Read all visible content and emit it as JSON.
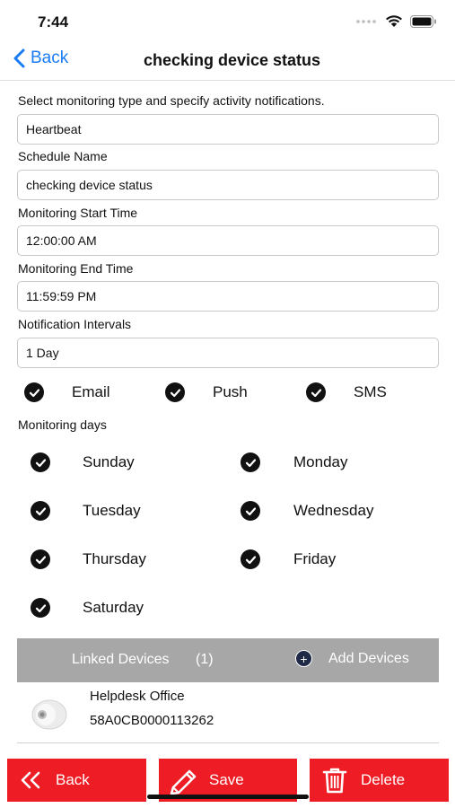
{
  "status": {
    "time": "7:44"
  },
  "nav": {
    "back_label": "Back",
    "title": "checking device status"
  },
  "form": {
    "instruction": "Select monitoring type and specify activity notifications.",
    "monitoring_type_value": "Heartbeat",
    "schedule_name_label": "Schedule Name",
    "schedule_name_value": "checking device status",
    "start_time_label": "Monitoring Start Time",
    "start_time_value": "12:00:00 AM",
    "end_time_label": "Monitoring End Time",
    "end_time_value": "11:59:59 PM",
    "interval_label": "Notification Intervals",
    "interval_value": "1 Day"
  },
  "notifications": [
    {
      "label": "Email",
      "checked": true
    },
    {
      "label": "Push",
      "checked": true
    },
    {
      "label": "SMS",
      "checked": true
    }
  ],
  "days": {
    "label": "Monitoring days",
    "items": [
      {
        "label": "Sunday",
        "checked": true
      },
      {
        "label": "Monday",
        "checked": true
      },
      {
        "label": "Tuesday",
        "checked": true
      },
      {
        "label": "Wednesday",
        "checked": true
      },
      {
        "label": "Thursday",
        "checked": true
      },
      {
        "label": "Friday",
        "checked": true
      },
      {
        "label": "Saturday",
        "checked": true
      }
    ]
  },
  "linked": {
    "title": "Linked Devices",
    "count": "(1)",
    "add_label": "Add Devices",
    "devices": [
      {
        "name": "Helpdesk Office",
        "id": "58A0CB0000113262"
      }
    ]
  },
  "buttons": {
    "back": "Back",
    "save": "Save",
    "delete": "Delete"
  },
  "colors": {
    "accent": "#1a7cf5",
    "action_red": "#ee1c24",
    "linked_bar": "#a7a7a7"
  }
}
